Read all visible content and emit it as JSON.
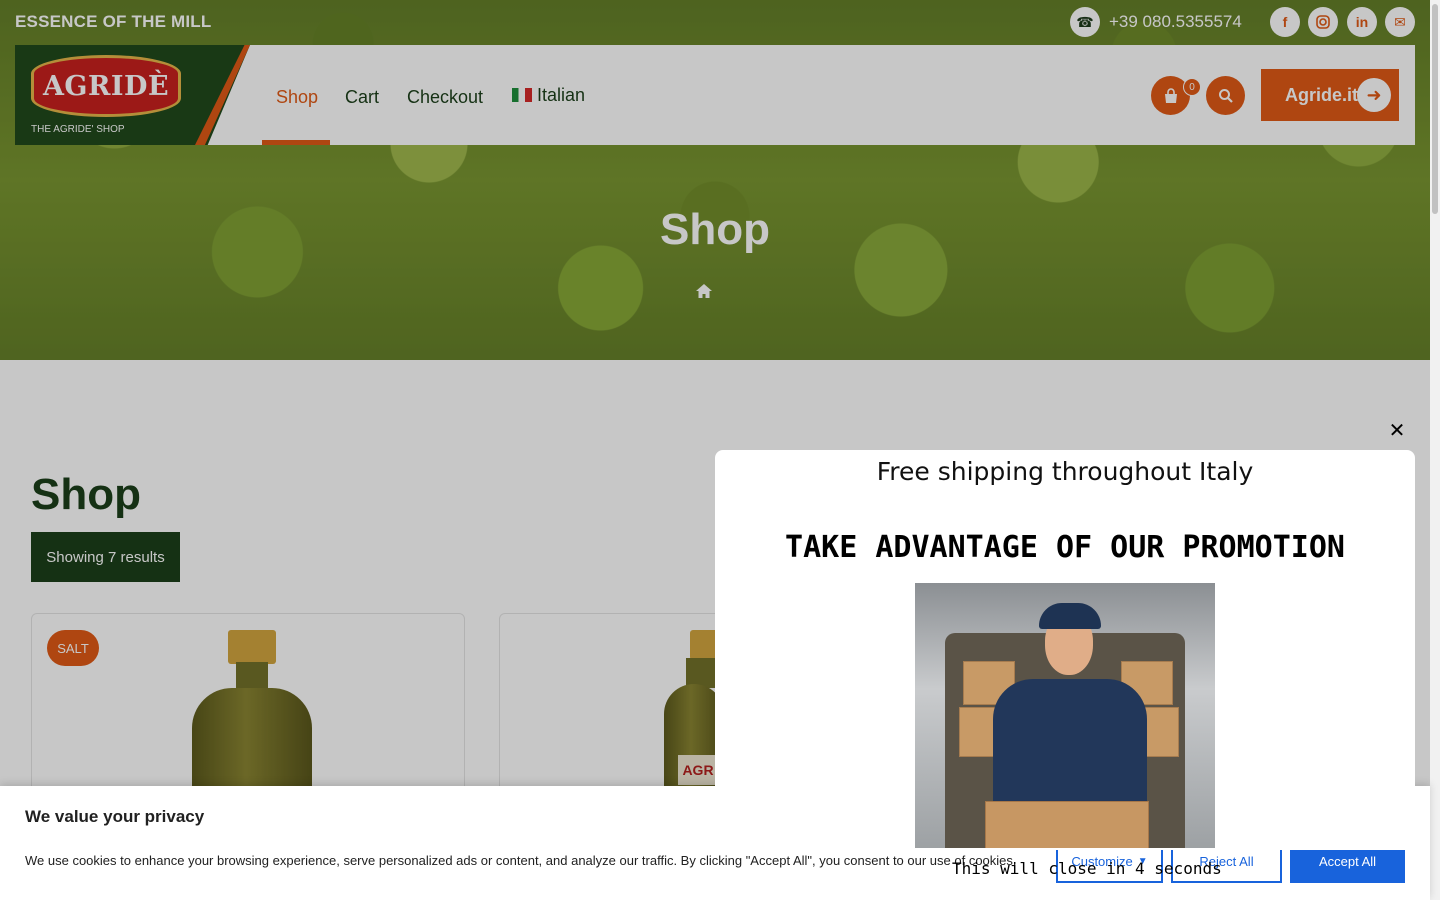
{
  "topbar": {
    "tagline": "ESSENCE OF THE MILL",
    "phone": "+39 080.5355574",
    "social_icons": [
      "facebook-icon",
      "instagram-icon",
      "linkedin-icon",
      "email-icon"
    ]
  },
  "header": {
    "logo_text": "AGRIDÈ",
    "logo_subtitle": "THE AGRIDE' SHOP",
    "nav": [
      {
        "label": "Shop",
        "active": true
      },
      {
        "label": "Cart",
        "active": false
      },
      {
        "label": "Checkout",
        "active": false
      },
      {
        "label": "Italian",
        "active": false,
        "icon": "italy-flag-icon"
      }
    ],
    "cart_count": "0",
    "cta_label": "Agride.it"
  },
  "hero": {
    "title": "Shop",
    "breadcrumb_icon": "home-icon"
  },
  "shop": {
    "heading": "Shop",
    "results_text": "Showing 7 results",
    "products": [
      {
        "badge": "SALT"
      },
      {
        "label_text": "AGR"
      }
    ]
  },
  "popup": {
    "shipping_text": "Free shipping throughout Italy",
    "promo_heading": "TAKE ADVANTAGE OF OUR PROMOTION",
    "close_icon": "close-icon",
    "countdown_text": "This will close in 4 seconds"
  },
  "cookie": {
    "title": "We value your privacy",
    "text": "We use cookies to enhance your browsing experience, serve personalized ads or content, and analyze our traffic. By clicking \"Accept All\", you consent to our use of cookies.",
    "customize_label": "Customize",
    "reject_label": "Reject All",
    "accept_label": "Accept All"
  },
  "colors": {
    "brand_orange": "#e05a16",
    "brand_green": "#1c3f1a",
    "cookie_blue": "#1863dc"
  }
}
